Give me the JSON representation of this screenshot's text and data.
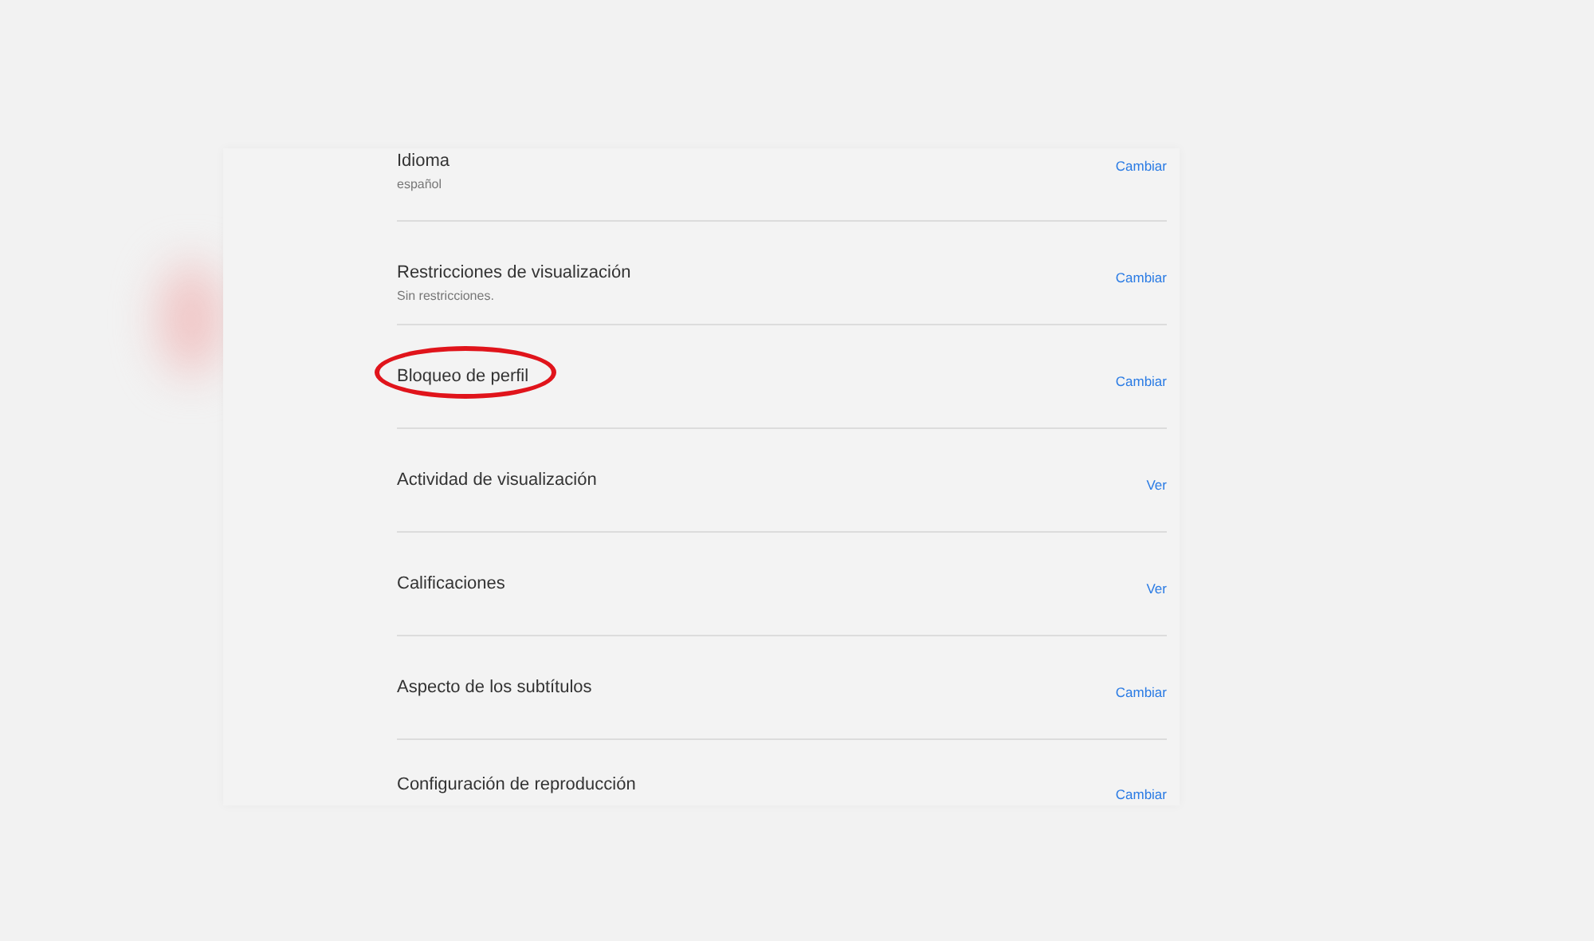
{
  "settings": [
    {
      "title": "Idioma",
      "subtitle": "español",
      "action": "Cambiar",
      "highlighted": false
    },
    {
      "title": "Restricciones de visualización",
      "subtitle": "Sin restricciones.",
      "action": "Cambiar",
      "highlighted": false
    },
    {
      "title": "Bloqueo de perfil",
      "action": "Cambiar",
      "highlighted": true
    },
    {
      "title": "Actividad de visualización",
      "action": "Ver",
      "highlighted": false
    },
    {
      "title": "Calificaciones",
      "action": "Ver",
      "highlighted": false
    },
    {
      "title": "Aspecto de los subtítulos",
      "action": "Cambiar",
      "highlighted": false
    },
    {
      "title": "Configuración de reproducción",
      "action": "Cambiar",
      "highlighted": false
    }
  ]
}
